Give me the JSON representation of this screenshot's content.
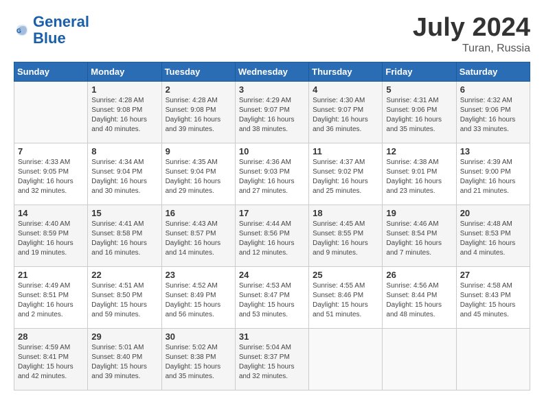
{
  "header": {
    "logo_general": "General",
    "logo_blue": "Blue",
    "month_year": "July 2024",
    "location": "Turan, Russia"
  },
  "calendar": {
    "days_of_week": [
      "Sunday",
      "Monday",
      "Tuesday",
      "Wednesday",
      "Thursday",
      "Friday",
      "Saturday"
    ],
    "weeks": [
      [
        {
          "day": "",
          "content": ""
        },
        {
          "day": "1",
          "content": "Sunrise: 4:28 AM\nSunset: 9:08 PM\nDaylight: 16 hours\nand 40 minutes."
        },
        {
          "day": "2",
          "content": "Sunrise: 4:28 AM\nSunset: 9:08 PM\nDaylight: 16 hours\nand 39 minutes."
        },
        {
          "day": "3",
          "content": "Sunrise: 4:29 AM\nSunset: 9:07 PM\nDaylight: 16 hours\nand 38 minutes."
        },
        {
          "day": "4",
          "content": "Sunrise: 4:30 AM\nSunset: 9:07 PM\nDaylight: 16 hours\nand 36 minutes."
        },
        {
          "day": "5",
          "content": "Sunrise: 4:31 AM\nSunset: 9:06 PM\nDaylight: 16 hours\nand 35 minutes."
        },
        {
          "day": "6",
          "content": "Sunrise: 4:32 AM\nSunset: 9:06 PM\nDaylight: 16 hours\nand 33 minutes."
        }
      ],
      [
        {
          "day": "7",
          "content": "Sunrise: 4:33 AM\nSunset: 9:05 PM\nDaylight: 16 hours\nand 32 minutes."
        },
        {
          "day": "8",
          "content": "Sunrise: 4:34 AM\nSunset: 9:04 PM\nDaylight: 16 hours\nand 30 minutes."
        },
        {
          "day": "9",
          "content": "Sunrise: 4:35 AM\nSunset: 9:04 PM\nDaylight: 16 hours\nand 29 minutes."
        },
        {
          "day": "10",
          "content": "Sunrise: 4:36 AM\nSunset: 9:03 PM\nDaylight: 16 hours\nand 27 minutes."
        },
        {
          "day": "11",
          "content": "Sunrise: 4:37 AM\nSunset: 9:02 PM\nDaylight: 16 hours\nand 25 minutes."
        },
        {
          "day": "12",
          "content": "Sunrise: 4:38 AM\nSunset: 9:01 PM\nDaylight: 16 hours\nand 23 minutes."
        },
        {
          "day": "13",
          "content": "Sunrise: 4:39 AM\nSunset: 9:00 PM\nDaylight: 16 hours\nand 21 minutes."
        }
      ],
      [
        {
          "day": "14",
          "content": "Sunrise: 4:40 AM\nSunset: 8:59 PM\nDaylight: 16 hours\nand 19 minutes."
        },
        {
          "day": "15",
          "content": "Sunrise: 4:41 AM\nSunset: 8:58 PM\nDaylight: 16 hours\nand 16 minutes."
        },
        {
          "day": "16",
          "content": "Sunrise: 4:43 AM\nSunset: 8:57 PM\nDaylight: 16 hours\nand 14 minutes."
        },
        {
          "day": "17",
          "content": "Sunrise: 4:44 AM\nSunset: 8:56 PM\nDaylight: 16 hours\nand 12 minutes."
        },
        {
          "day": "18",
          "content": "Sunrise: 4:45 AM\nSunset: 8:55 PM\nDaylight: 16 hours\nand 9 minutes."
        },
        {
          "day": "19",
          "content": "Sunrise: 4:46 AM\nSunset: 8:54 PM\nDaylight: 16 hours\nand 7 minutes."
        },
        {
          "day": "20",
          "content": "Sunrise: 4:48 AM\nSunset: 8:53 PM\nDaylight: 16 hours\nand 4 minutes."
        }
      ],
      [
        {
          "day": "21",
          "content": "Sunrise: 4:49 AM\nSunset: 8:51 PM\nDaylight: 16 hours\nand 2 minutes."
        },
        {
          "day": "22",
          "content": "Sunrise: 4:51 AM\nSunset: 8:50 PM\nDaylight: 15 hours\nand 59 minutes."
        },
        {
          "day": "23",
          "content": "Sunrise: 4:52 AM\nSunset: 8:49 PM\nDaylight: 15 hours\nand 56 minutes."
        },
        {
          "day": "24",
          "content": "Sunrise: 4:53 AM\nSunset: 8:47 PM\nDaylight: 15 hours\nand 53 minutes."
        },
        {
          "day": "25",
          "content": "Sunrise: 4:55 AM\nSunset: 8:46 PM\nDaylight: 15 hours\nand 51 minutes."
        },
        {
          "day": "26",
          "content": "Sunrise: 4:56 AM\nSunset: 8:44 PM\nDaylight: 15 hours\nand 48 minutes."
        },
        {
          "day": "27",
          "content": "Sunrise: 4:58 AM\nSunset: 8:43 PM\nDaylight: 15 hours\nand 45 minutes."
        }
      ],
      [
        {
          "day": "28",
          "content": "Sunrise: 4:59 AM\nSunset: 8:41 PM\nDaylight: 15 hours\nand 42 minutes."
        },
        {
          "day": "29",
          "content": "Sunrise: 5:01 AM\nSunset: 8:40 PM\nDaylight: 15 hours\nand 39 minutes."
        },
        {
          "day": "30",
          "content": "Sunrise: 5:02 AM\nSunset: 8:38 PM\nDaylight: 15 hours\nand 35 minutes."
        },
        {
          "day": "31",
          "content": "Sunrise: 5:04 AM\nSunset: 8:37 PM\nDaylight: 15 hours\nand 32 minutes."
        },
        {
          "day": "",
          "content": ""
        },
        {
          "day": "",
          "content": ""
        },
        {
          "day": "",
          "content": ""
        }
      ]
    ]
  }
}
